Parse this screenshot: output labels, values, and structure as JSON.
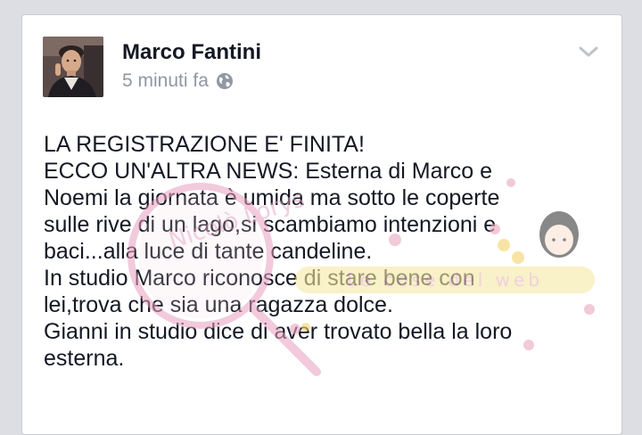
{
  "post": {
    "author": "Marco Fantini",
    "timestamp": "5 minuti fa",
    "privacy_icon": "globe-icon",
    "menu_icon": "chevron-down-icon",
    "lines": [
      "LA REGISTRAZIONE E' FINITA!",
      "ECCO UN'ALTRA NEWS: Esterna di Marco e",
      "Noemi la giornata è umida ma sotto le coperte",
      "sulle rive di un lago,si scambiamo intenzioni e",
      "baci...alla luce di tante candeline.",
      "In studio Marco riconosce di stare bene con",
      "lei,trova che sia una ragazza dolce.",
      "Gianni in studio dice di aver trovato bella la loro",
      "esterna."
    ]
  },
  "watermark": {
    "left_text": "Nicolò Lorys",
    "right_text": "Le cose del web"
  },
  "colors": {
    "background": "#dcdee3",
    "card": "#ffffff",
    "author": "#141823",
    "meta": "#9197a3",
    "watermark_pink": "#e8a0c0",
    "watermark_yellow": "#f3e07a"
  }
}
